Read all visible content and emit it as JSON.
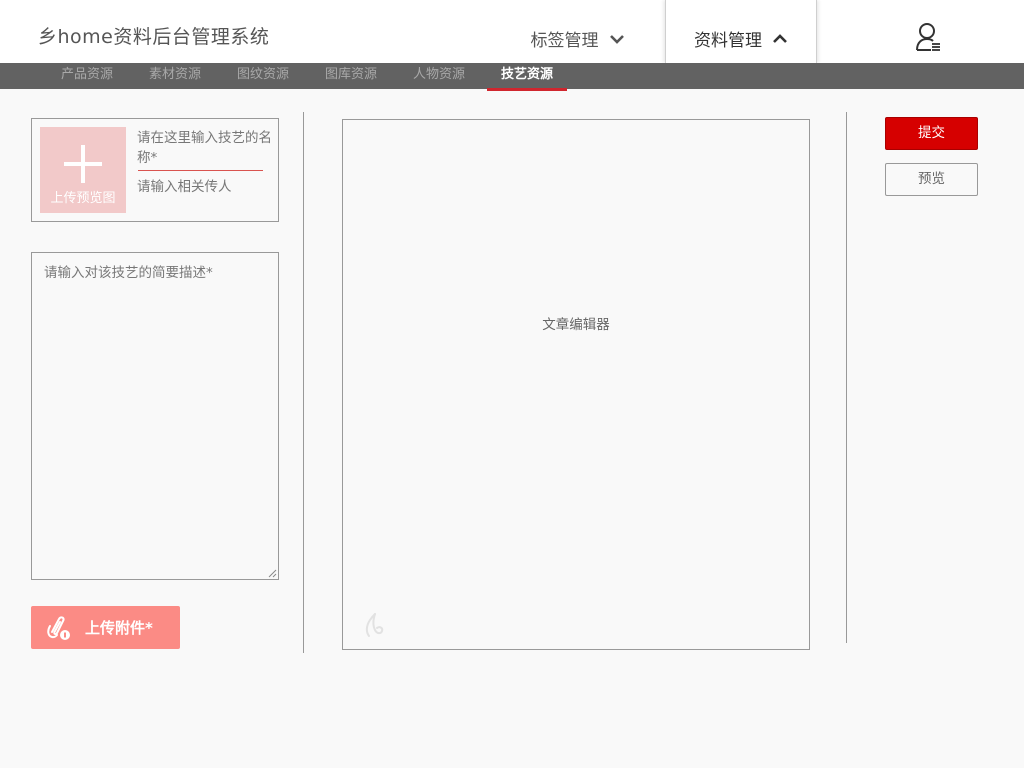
{
  "header": {
    "app_title": "乡home资料后台管理系统",
    "nav": [
      {
        "label": "标签管理",
        "icon": "chevron-down-icon"
      },
      {
        "label": "资料管理",
        "icon": "chevron-up-icon"
      }
    ],
    "user_icon": "user-menu-icon"
  },
  "subnav": {
    "items": [
      "产品资源",
      "素材资源",
      "图纹资源",
      "图库资源",
      "人物资源",
      "技艺资源"
    ],
    "active": "技艺资源"
  },
  "form": {
    "upload_preview_label": "上传预览图",
    "name_placeholder": "请在这里输入技艺的名称*",
    "inheritor_placeholder": "请输入相关传人",
    "description_placeholder": "请输入对该技艺的简要描述*",
    "attach_label": "上传附件*"
  },
  "editor": {
    "placeholder": "文章编辑器"
  },
  "actions": {
    "submit_label": "提交",
    "preview_label": "预览"
  },
  "colors": {
    "accent": "#d60000",
    "attach_button": "#fb8b85",
    "upload_preview_bg": "#f2c9c9",
    "subnav_bg": "#626262",
    "active_underline": "#d0262e"
  }
}
